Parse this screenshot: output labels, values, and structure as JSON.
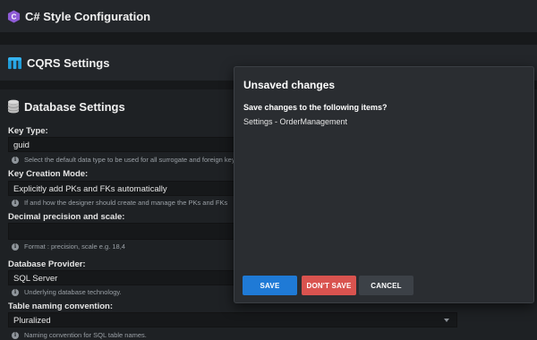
{
  "sections": {
    "csharp": {
      "title": "C# Style Configuration",
      "icon": "csharp-logo-icon"
    },
    "cqrs": {
      "title": "CQRS Settings",
      "icon": "cqrs-logo-icon"
    },
    "database": {
      "title": "Database Settings",
      "icon": "database-icon"
    }
  },
  "fields": {
    "key_type": {
      "label": "Key Type:",
      "value": "guid",
      "hint": "Select the default data type to be used for all surrogate and foreign keys."
    },
    "key_creation_mode": {
      "label": "Key Creation Mode:",
      "value": "Explicitly add PKs and FKs automatically",
      "hint": "If and how the designer should create and manage the PKs and FKs"
    },
    "decimal_precision": {
      "label": "Decimal precision and scale:",
      "value": "",
      "hint": "Format : precision, scale e.g. 18,4"
    },
    "database_provider": {
      "label": "Database Provider:",
      "value": "SQL Server",
      "hint": "Underlying database technology."
    },
    "table_naming": {
      "label": "Table naming convention:",
      "value": "Pluralized",
      "hint": "Naming convention for SQL table names."
    }
  },
  "dialog": {
    "title": "Unsaved changes",
    "question": "Save changes to the following items?",
    "item": "Settings - OrderManagement",
    "save_label": "SAVE",
    "dont_save_label": "DON'T SAVE",
    "cancel_label": "CANCEL"
  },
  "colors": {
    "background": "#1e2124",
    "dialog": "#2a2d31",
    "save": "#1f7ad6",
    "dont_save": "#d9534f",
    "cancel": "#3c4147"
  }
}
